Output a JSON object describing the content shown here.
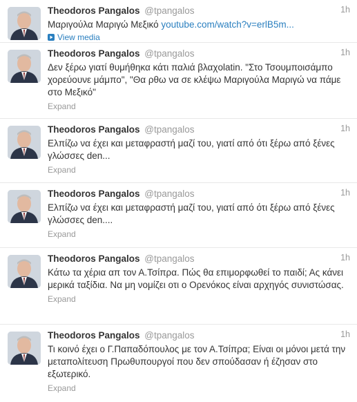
{
  "tweets": [
    {
      "name": "Theodoros Pangalos",
      "handle": "@tpangalos",
      "time": "1h",
      "text": "Μαριγούλα Μαριγώ Μεξικό ",
      "link": "youtube.com/watch?v=erlB5m...",
      "action": "View media"
    },
    {
      "name": "Theodoros Pangalos",
      "handle": "@tpangalos",
      "time": "1h",
      "text": "Δεν ξέρω γιατί θυμήθηκα κάτι παλιά βλαχolatin. \"Στο Τσουμποισάμπο χορεύουνε μάμπο\", \"Θα ρθω να σε κλέψω Μαριγούλα Μαριγώ να πάμε στο Μεξικό\"",
      "action": "Expand"
    },
    {
      "name": "Theodoros Pangalos",
      "handle": "@tpangalos",
      "time": "1h",
      "text": "Ελπίζω να έχει και μεταφραστή μαζί του, γιατί από ότι ξέρω από ξένες γλώσσες den...",
      "action": "Expand"
    },
    {
      "name": "Theodoros Pangalos",
      "handle": "@tpangalos",
      "time": "1h",
      "text": "Ελπίζω να έχει και μεταφραστή μαζί του, γιατί από ότι ξέρω από ξένες γλώσσες den....",
      "action": "Expand"
    },
    {
      "name": "Theodoros Pangalos",
      "handle": "@tpangalos",
      "time": "1h",
      "text": "Κάτω τα χέρια απ τον Α.Τσίπρα. Πώς θα επιμορφωθεί το παιδί; Ας κάνει μερικά ταξίδια. Να μη νομίζει οτι ο Ορενόκος είναι αρχηγός συνιστώσας.",
      "action": "Expand"
    },
    {
      "name": "Theodoros Pangalos",
      "handle": "@tpangalos",
      "time": "1h",
      "text": "Τι κοινό έχει ο Γ.Παπαδόπουλος με τον Α.Τσίπρα; Είναι οι μόνοι μετά την μεταπολίτευση Πρωθυπουργοί που δεν σπούδασαν ή έζησαν στο εξωτερικό.",
      "action": "Expand"
    }
  ],
  "colors": {
    "link": "#2a7fbf",
    "muted": "#999999",
    "text": "#333333",
    "divider": "#e8e8e8"
  }
}
